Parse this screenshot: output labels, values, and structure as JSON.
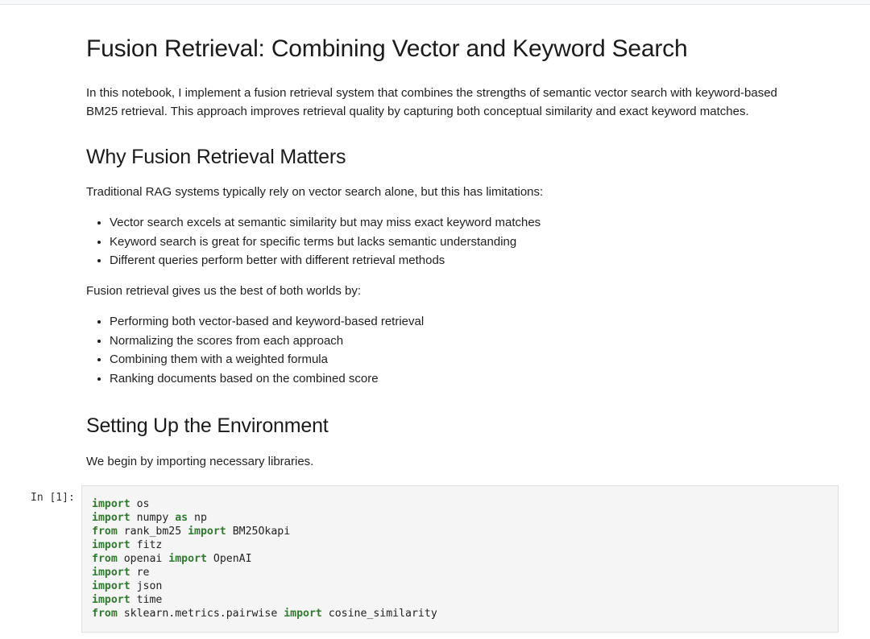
{
  "title": "Fusion Retrieval: Combining Vector and Keyword Search",
  "intro": "In this notebook, I implement a fusion retrieval system that combines the strengths of semantic vector search with keyword-based BM25 retrieval. This approach improves retrieval quality by capturing both conceptual similarity and exact keyword matches.",
  "section1": {
    "heading": "Why Fusion Retrieval Matters",
    "para": "Traditional RAG systems typically rely on vector search alone, but this has limitations:",
    "bullets": [
      "Vector search excels at semantic similarity but may miss exact keyword matches",
      "Keyword search is great for specific terms but lacks semantic understanding",
      "Different queries perform better with different retrieval methods"
    ],
    "para2": "Fusion retrieval gives us the best of both worlds by:",
    "bullets2": [
      "Performing both vector-based and keyword-based retrieval",
      "Normalizing the scores from each approach",
      "Combining them with a weighted formula",
      "Ranking documents based on the combined score"
    ]
  },
  "section2": {
    "heading": "Setting Up the Environment",
    "para": "We begin by importing necessary libraries."
  },
  "cell": {
    "prompt": "In [1]:",
    "lines": [
      {
        "kw1": "import",
        "rest": " os"
      },
      {
        "kw1": "import",
        "rest": " numpy ",
        "kw2": "as",
        "rest2": " np"
      },
      {
        "kw1": "from",
        "rest": " rank_bm25 ",
        "kw2": "import",
        "rest2": " BM25Okapi"
      },
      {
        "kw1": "import",
        "rest": " fitz"
      },
      {
        "kw1": "from",
        "rest": " openai ",
        "kw2": "import",
        "rest2": " OpenAI"
      },
      {
        "kw1": "import",
        "rest": " re"
      },
      {
        "kw1": "import",
        "rest": " json"
      },
      {
        "kw1": "import",
        "rest": " time"
      },
      {
        "kw1": "from",
        "rest": " sklearn.metrics.pairwise ",
        "kw2": "import",
        "rest2": " cosine_similarity"
      }
    ]
  }
}
